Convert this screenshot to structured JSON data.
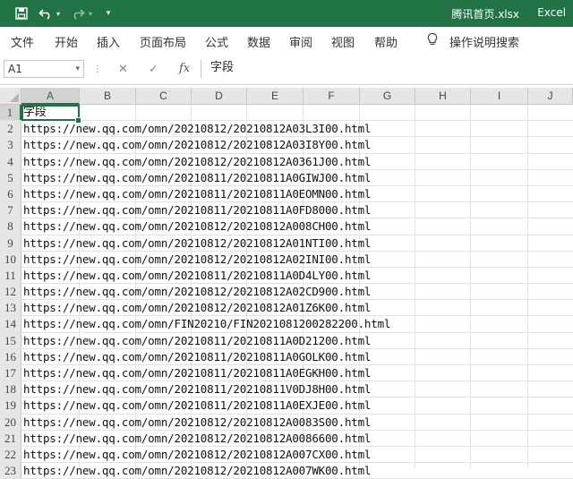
{
  "window": {
    "title": "腾讯首页.xlsx",
    "app_name": "Excel",
    "colors": {
      "title_bar": "#217346",
      "accent": "#217346"
    }
  },
  "quick_access": {
    "save_icon": "save-icon",
    "undo_icon": "undo-icon",
    "redo_icon": "redo-icon",
    "customize_icon": "customize-icon"
  },
  "ribbon": {
    "tabs": [
      "文件",
      "开始",
      "插入",
      "页面布局",
      "公式",
      "数据",
      "审阅",
      "视图",
      "帮助"
    ],
    "search_label": "操作说明搜索"
  },
  "formula_bar": {
    "name_box": "A1",
    "cancel_symbol": "✕",
    "enter_symbol": "✓",
    "fx_label": "fx",
    "content": "字段"
  },
  "sheet": {
    "columns": [
      "A",
      "B",
      "C",
      "D",
      "E",
      "F",
      "G",
      "H",
      "I",
      "J"
    ],
    "selected_cell": "A1",
    "rows": [
      {
        "num": "1",
        "value": "字段"
      },
      {
        "num": "2",
        "value": "https://new.qq.com/omn/20210812/20210812A03L3I00.html"
      },
      {
        "num": "3",
        "value": "https://new.qq.com/omn/20210812/20210812A03I8Y00.html"
      },
      {
        "num": "4",
        "value": "https://new.qq.com/omn/20210812/20210812A0361J00.html"
      },
      {
        "num": "5",
        "value": "https://new.qq.com/omn/20210811/20210811A0GIWJ00.html"
      },
      {
        "num": "6",
        "value": "https://new.qq.com/omn/20210811/20210811A0EOMN00.html"
      },
      {
        "num": "7",
        "value": "https://new.qq.com/omn/20210811/20210811A0FD8000.html"
      },
      {
        "num": "8",
        "value": "https://new.qq.com/omn/20210812/20210812A008CH00.html"
      },
      {
        "num": "9",
        "value": "https://new.qq.com/omn/20210812/20210812A01NTI00.html"
      },
      {
        "num": "10",
        "value": "https://new.qq.com/omn/20210812/20210812A02INI00.html"
      },
      {
        "num": "11",
        "value": "https://new.qq.com/omn/20210811/20210811A0D4LY00.html"
      },
      {
        "num": "12",
        "value": "https://new.qq.com/omn/20210812/20210812A02CD900.html"
      },
      {
        "num": "13",
        "value": "https://new.qq.com/omn/20210812/20210812A01Z6K00.html"
      },
      {
        "num": "14",
        "value": "https://new.qq.com/omn/FIN20210/FIN2021081200282200.html"
      },
      {
        "num": "15",
        "value": "https://new.qq.com/omn/20210811/20210811A0D21200.html"
      },
      {
        "num": "16",
        "value": "https://new.qq.com/omn/20210811/20210811A0GOLK00.html"
      },
      {
        "num": "17",
        "value": "https://new.qq.com/omn/20210811/20210811A0EGKH00.html"
      },
      {
        "num": "18",
        "value": "https://new.qq.com/omn/20210811/20210811V0DJ8H00.html"
      },
      {
        "num": "19",
        "value": "https://new.qq.com/omn/20210811/20210811A0EXJE00.html"
      },
      {
        "num": "20",
        "value": "https://new.qq.com/omn/20210812/20210812A0083S00.html"
      },
      {
        "num": "21",
        "value": "https://new.qq.com/omn/20210812/20210812A0086600.html"
      },
      {
        "num": "22",
        "value": "https://new.qq.com/omn/20210812/20210812A007CX00.html"
      },
      {
        "num": "23",
        "value": "https://new.qq.com/omn/20210812/20210812A007WK00.html"
      }
    ]
  }
}
